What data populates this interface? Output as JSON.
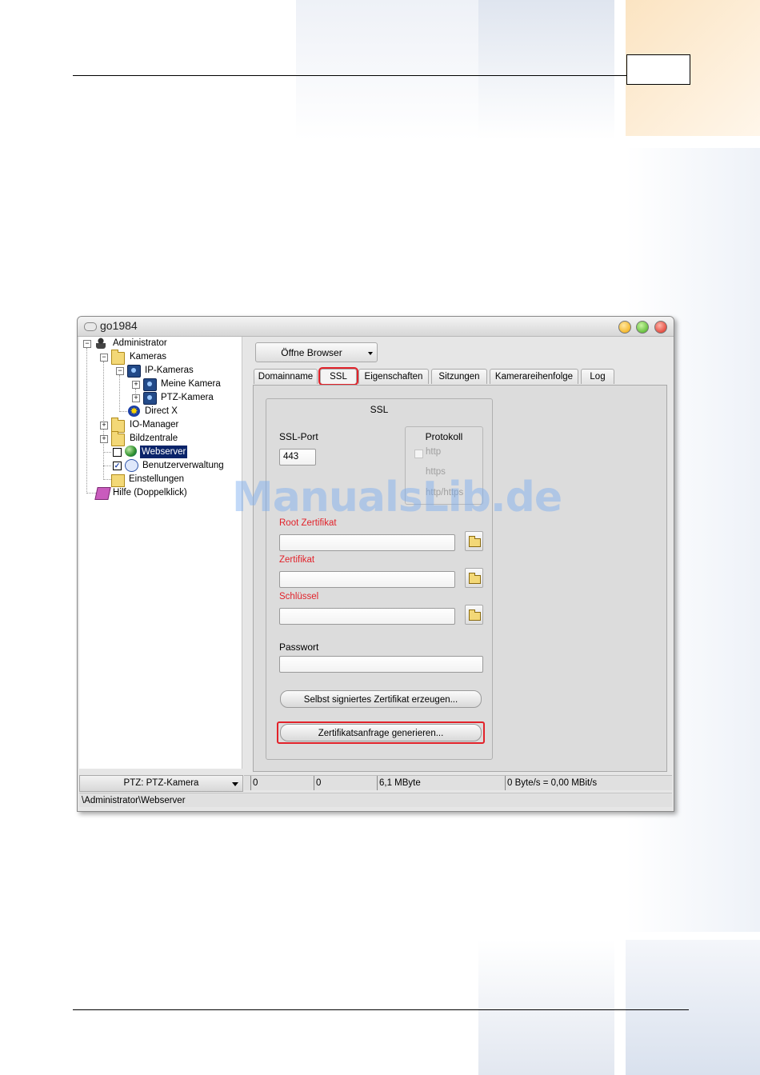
{
  "window": {
    "title": "go1984"
  },
  "tree": {
    "items": [
      {
        "label": "Administrator"
      },
      {
        "label": "Kameras"
      },
      {
        "label": "IP-Kameras"
      },
      {
        "label": "Meine Kamera"
      },
      {
        "label": "PTZ-Kamera"
      },
      {
        "label": "Direct X"
      },
      {
        "label": "IO-Manager"
      },
      {
        "label": "Bildzentrale"
      },
      {
        "label": "Webserver"
      },
      {
        "label": "Benutzerverwaltung"
      },
      {
        "label": "Einstellungen"
      },
      {
        "label": "Hilfe (Doppelklick)"
      }
    ]
  },
  "ptz_combo": {
    "value": "PTZ: PTZ-Kamera"
  },
  "toolbar": {
    "open_browser_label": "Öffne Browser"
  },
  "tabs": [
    {
      "label": "Domainname"
    },
    {
      "label": "SSL"
    },
    {
      "label": "Eigenschaften"
    },
    {
      "label": "Sitzungen"
    },
    {
      "label": "Kamerareihenfolge"
    },
    {
      "label": "Log"
    }
  ],
  "ssl": {
    "group_title": "SSL",
    "port_label": "SSL-Port",
    "port_value": "443",
    "protocol": {
      "title": "Protokoll",
      "options": [
        "http",
        "https",
        "http/https"
      ]
    },
    "root_cert_label": "Root Zertifikat",
    "root_cert_value": "",
    "cert_label": "Zertifikat",
    "cert_value": "",
    "key_label": "Schlüssel",
    "key_value": "",
    "password_label": "Passwort",
    "password_value": "",
    "self_signed_button": "Selbst signiertes Zertifikat erzeugen...",
    "request_button": "Zertifikatsanfrage generieren..."
  },
  "status": {
    "field1": "0",
    "field2": "0",
    "size": "6,1 MByte",
    "rate": "0 Byte/s = 0,00 MBit/s"
  },
  "path": "\\Administrator\\Webserver",
  "watermark": "ManualsLib.de",
  "colors": {
    "highlight_red": "#e2222a",
    "selection_blue": "#0a246a",
    "required_label": "#e2222a"
  }
}
